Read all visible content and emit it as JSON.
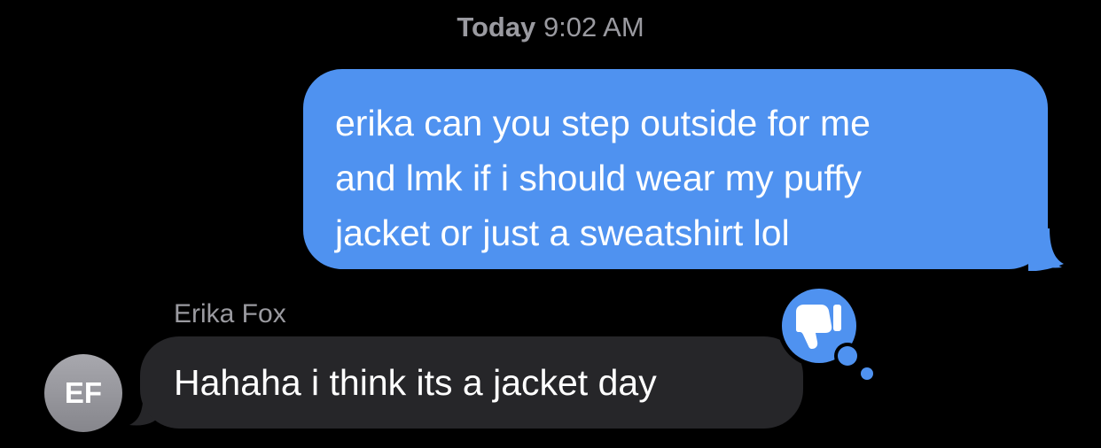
{
  "timestamp": {
    "day": "Today",
    "time": "9:02 AM"
  },
  "colors": {
    "background": "#000000",
    "outgoing_bubble": "#4f92f0",
    "incoming_bubble": "#262629",
    "secondary_text": "#9a9aa0",
    "avatar": "#9a9aa0"
  },
  "messages": {
    "outgoing": {
      "lines": [
        "erika can you step outside for me",
        "and lmk if i should wear my puffy",
        "jacket or just a sweatshirt lol"
      ]
    },
    "incoming": {
      "sender_name": "Erika Fox",
      "avatar_initials": "EF",
      "text": "Hahaha i think its a jacket day",
      "tapback_icon": "thumbs-down-icon"
    }
  }
}
